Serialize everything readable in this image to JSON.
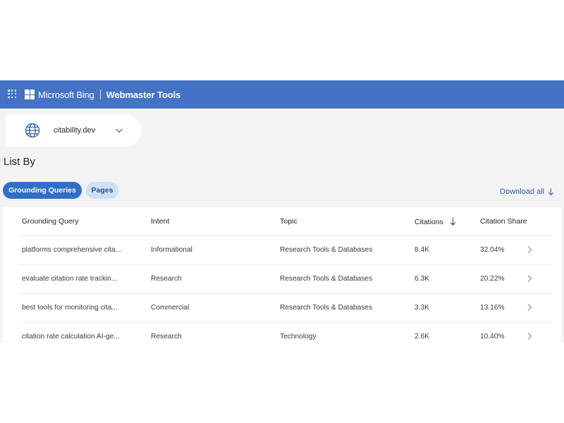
{
  "header": {
    "brand": "Microsoft Bing",
    "product": "Webmaster Tools",
    "accent_color": "#4472c4",
    "menu_icon": "app-launcher-icon",
    "logo_icon": "microsoft-logo-icon"
  },
  "site_picker": {
    "site": "citability.dev",
    "icon": "globe-icon",
    "expand_icon": "chevron-down-icon"
  },
  "list_by": {
    "heading": "List By",
    "tabs": [
      {
        "label": "Grounding Queries",
        "selected": true
      },
      {
        "label": "Pages",
        "selected": false
      }
    ]
  },
  "download": {
    "label": "Download all",
    "icon": "download-arrow-icon"
  },
  "table": {
    "columns": [
      "Grounding Query",
      "Intent",
      "Topic",
      "Citations",
      "Citation Share"
    ],
    "sort_column": "Citations",
    "sort_direction": "descending",
    "rows": [
      {
        "query": "platforms comprehensive cita...",
        "intent": "Informational",
        "topic": "Research Tools & Databases",
        "citations": "8.4K",
        "share": "32.04%"
      },
      {
        "query": "evaluate citation rate trackin...",
        "intent": "Research",
        "topic": "Research Tools & Databases",
        "citations": "6.3K",
        "share": "20.22%"
      },
      {
        "query": "best tools for monitoring cita...",
        "intent": "Commercial",
        "topic": "Research Tools & Databases",
        "citations": "3.3K",
        "share": "13.16%"
      },
      {
        "query": "citation rate calculation AI-ge...",
        "intent": "Research",
        "topic": "Technology",
        "citations": "2.6K",
        "share": "10.40%"
      }
    ]
  }
}
